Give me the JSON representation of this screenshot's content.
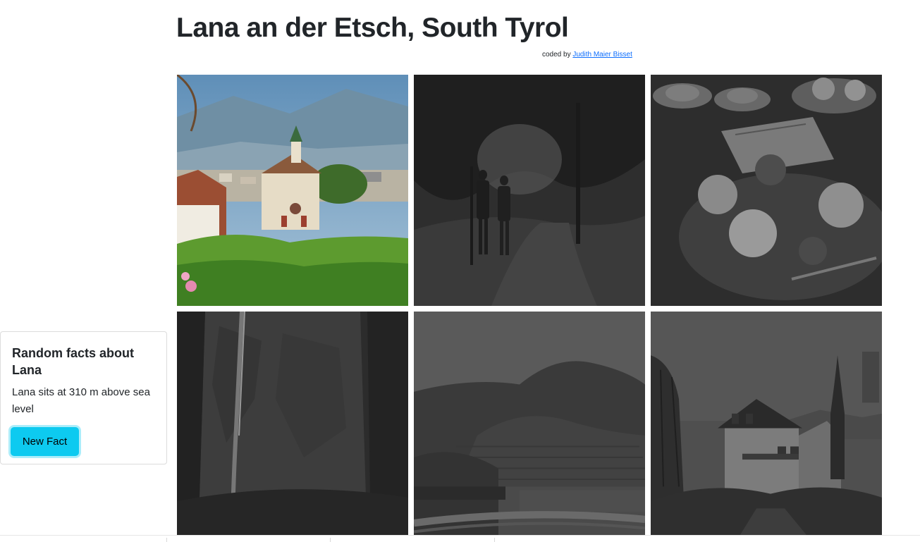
{
  "header": {
    "title": "Lana an der Etsch, South Tyrol",
    "credit_prefix": "coded by",
    "credit_link": "Judith Maier Bisset"
  },
  "fact_card": {
    "title": "Random facts about Lana",
    "fact": "Lana sits at 310 m above sea level",
    "button_label": "New Fact"
  },
  "gallery": {
    "photos": [
      {
        "name": "chapel-photo",
        "style": "color"
      },
      {
        "name": "forest-path-photo",
        "style": "grayscale"
      },
      {
        "name": "figs-dessert-photo",
        "style": "grayscale"
      },
      {
        "name": "waterfall-photo",
        "style": "grayscale"
      },
      {
        "name": "mountain-vineyard-photo",
        "style": "grayscale"
      },
      {
        "name": "guesthouse-photo",
        "style": "grayscale"
      }
    ]
  }
}
